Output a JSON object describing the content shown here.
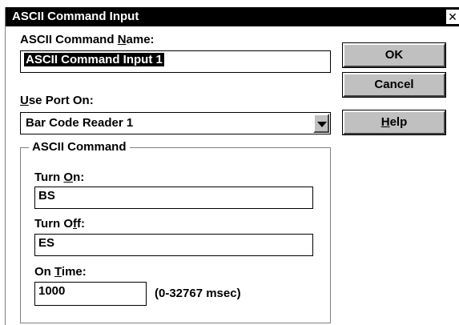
{
  "window": {
    "title": "ASCII Command Input",
    "close_glyph": "✕"
  },
  "command_name": {
    "label_pre": "ASCII Command ",
    "label_key": "N",
    "label_post": "ame:",
    "value": "ASCII Command Input 1"
  },
  "port": {
    "label_key": "U",
    "label_post": "se Port On:",
    "selected": "Bar Code Reader 1"
  },
  "ascii_command": {
    "group_label": "ASCII Command",
    "turn_on": {
      "label_pre": "Turn ",
      "label_key": "O",
      "label_post": "n:",
      "value": "BS"
    },
    "turn_off": {
      "label_pre": "Turn O",
      "label_key": "f",
      "label_post": "f:",
      "value": "ES"
    },
    "on_time": {
      "label_pre": "On ",
      "label_key": "T",
      "label_post": "ime:",
      "value": "1000",
      "range_hint": "(0-32767 msec)"
    }
  },
  "buttons": {
    "ok": "OK",
    "cancel": "Cancel",
    "help_key": "H",
    "help_post": "elp"
  }
}
